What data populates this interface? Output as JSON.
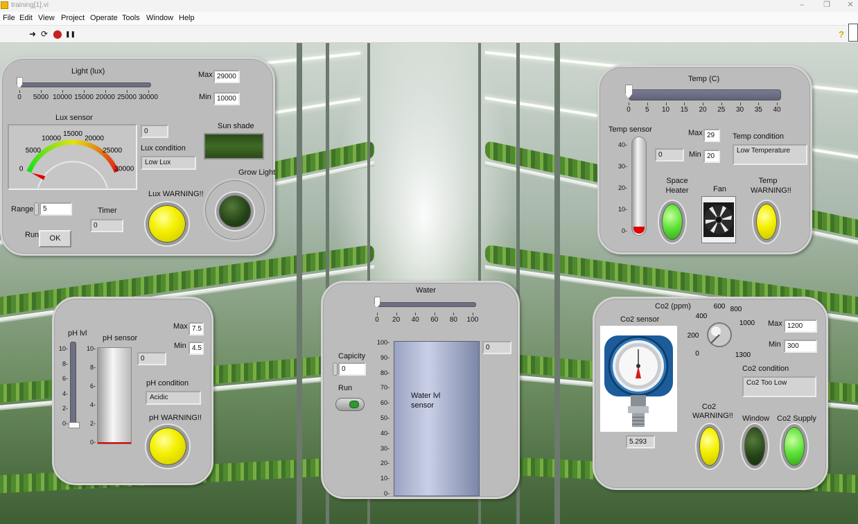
{
  "window": {
    "title": "training[1].vi"
  },
  "menu": [
    "File",
    "Edit",
    "View",
    "Project",
    "Operate",
    "Tools",
    "Window",
    "Help"
  ],
  "toolbar": {
    "run": "➜",
    "run_continuous": "⟳",
    "abort": "⬤",
    "pause": "❚❚",
    "help": "?"
  },
  "light": {
    "title": "Light (lux)",
    "slider_value": 0,
    "slider_max": 30000,
    "ticks": [
      "0",
      "5000",
      "10000",
      "15000",
      "20000",
      "25000",
      "30000"
    ],
    "max_label": "Max",
    "max_value": "29000",
    "min_label": "Min",
    "min_value": "10000",
    "gauge_title": "Lux sensor",
    "gauge_ticks": [
      "0",
      "5000",
      "10000",
      "15000",
      "20000",
      "25000",
      "30000"
    ],
    "gauge_value": 0,
    "sensor_readout": "0",
    "condition_label": "Lux condition",
    "condition_value": "Low Lux",
    "sunshade_label": "Sun shade",
    "growlight_label": "Grow Light",
    "warning_label": "Lux WARNING!!",
    "range_label": "Range",
    "range_value": "5",
    "timer_label": "Timer",
    "timer_value": "0",
    "run_label": "Run",
    "ok_label": "OK"
  },
  "temp": {
    "title": "Temp (C)",
    "slider_value": 0,
    "slider_max": 40,
    "ticks": [
      "0",
      "5",
      "10",
      "15",
      "20",
      "25",
      "30",
      "35",
      "40"
    ],
    "sensor_label": "Temp sensor",
    "scale": [
      "40",
      "30",
      "20",
      "10",
      "0"
    ],
    "level": 0,
    "readout": "0",
    "max_label": "Max",
    "max_value": "29",
    "min_label": "Min",
    "min_value": "20",
    "condition_label": "Temp condition",
    "condition_value": "Low Temperature",
    "heater_label_1": "Space",
    "heater_label_2": "Heater",
    "fan_label": "Fan",
    "warning_label_1": "Temp",
    "warning_label_2": "WARNING!!"
  },
  "ph": {
    "lvl_label": "pH lvl",
    "lvl_scale": [
      "10",
      "8",
      "6",
      "4",
      "2",
      "0"
    ],
    "lvl_value": 0,
    "sensor_label": "pH sensor",
    "sensor_scale": [
      "10",
      "8",
      "6",
      "4",
      "2",
      "0"
    ],
    "sensor_level": 0,
    "readout": "0",
    "max_label": "Max",
    "max_value": "7.5",
    "min_label": "Min",
    "min_value": "4.5",
    "condition_label": "pH condition",
    "condition_value": "Acidic",
    "warning_label": "pH WARNING!!"
  },
  "water": {
    "title": "Water",
    "slider_value": 0,
    "slider_max": 100,
    "ticks": [
      "0",
      "20",
      "40",
      "60",
      "80",
      "100"
    ],
    "capacity_label": "Capicity",
    "capacity_value": "0",
    "run_label": "Run",
    "tank_scale": [
      "100",
      "90",
      "80",
      "70",
      "60",
      "50",
      "40",
      "30",
      "20",
      "10",
      "0"
    ],
    "tank_level": 0,
    "tank_label_1": "Water lvl",
    "tank_label_2": "sensor",
    "readout": "0"
  },
  "co2": {
    "title": "Co2 (ppm)",
    "knob_ticks": [
      "0",
      "200",
      "400",
      "600",
      "800",
      "1000",
      "1300"
    ],
    "sensor_label": "Co2 sensor",
    "sensor_readout": "5.293",
    "max_label": "Max",
    "max_value": "1200",
    "min_label": "Min",
    "min_value": "300",
    "condition_label": "Co2 condition",
    "condition_value": "Co2 Too Low",
    "warning_label_1": "Co2",
    "warning_label_2": "WARNING!!",
    "window_label": "Window",
    "supply_label": "Co2  Supply"
  },
  "colors": {
    "panel": "#bcbcbc",
    "led_yellow": "#f5f000",
    "led_green": "#5fe23a",
    "led_dark": "#244417",
    "thermo_red": "#e00000",
    "tank_fill": "#b8c0d8"
  }
}
